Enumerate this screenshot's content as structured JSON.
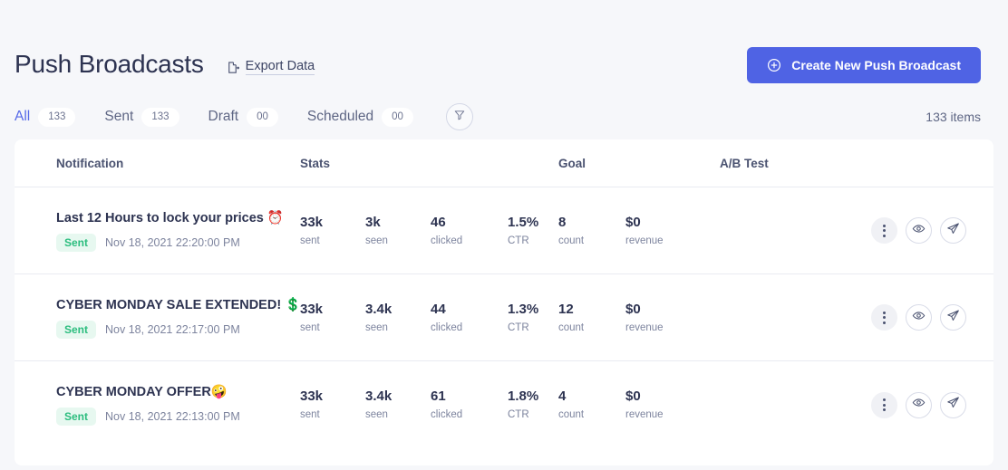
{
  "header": {
    "title": "Push Broadcasts",
    "export_label": "Export Data",
    "export_icon": "export-document-icon",
    "create_button_label": "Create New Push Broadcast",
    "create_button_icon": "plus-circle-icon",
    "accent_color": "#4f63e4"
  },
  "tabs": {
    "items": [
      {
        "label": "All",
        "count": "133",
        "active": true
      },
      {
        "label": "Sent",
        "count": "133",
        "active": false
      },
      {
        "label": "Draft",
        "count": "00",
        "active": false
      },
      {
        "label": "Scheduled",
        "count": "00",
        "active": false
      }
    ],
    "filter_icon": "funnel-filter-icon",
    "items_count": "133 items"
  },
  "table": {
    "columns": [
      "Notification",
      "Stats",
      "Goal",
      "A/B Test"
    ],
    "stat_labels": {
      "sent": "sent",
      "seen": "seen",
      "clicked": "clicked",
      "ctr": "CTR",
      "count": "count",
      "revenue": "revenue"
    },
    "rows": [
      {
        "title": "Last 12 Hours to lock your prices ⏰",
        "status": "Sent",
        "timestamp": "Nov 18, 2021 22:20:00 PM",
        "sent": "33k",
        "seen": "3k",
        "clicked": "46",
        "ctr": "1.5%",
        "count": "8",
        "revenue": "$0",
        "abtest": ""
      },
      {
        "title": "CYBER MONDAY SALE EXTENDED! 💲",
        "status": "Sent",
        "timestamp": "Nov 18, 2021 22:17:00 PM",
        "sent": "33k",
        "seen": "3.4k",
        "clicked": "44",
        "ctr": "1.3%",
        "count": "12",
        "revenue": "$0",
        "abtest": ""
      },
      {
        "title": "CYBER MONDAY OFFER🤪",
        "status": "Sent",
        "timestamp": "Nov 18, 2021 22:13:00 PM",
        "sent": "33k",
        "seen": "3.4k",
        "clicked": "61",
        "ctr": "1.8%",
        "count": "4",
        "revenue": "$0",
        "abtest": ""
      }
    ],
    "actions": {
      "more_icon": "more-vertical-icon",
      "preview_icon": "eye-icon",
      "send_icon": "paper-plane-icon"
    },
    "status_color": "#2bbd7e"
  }
}
